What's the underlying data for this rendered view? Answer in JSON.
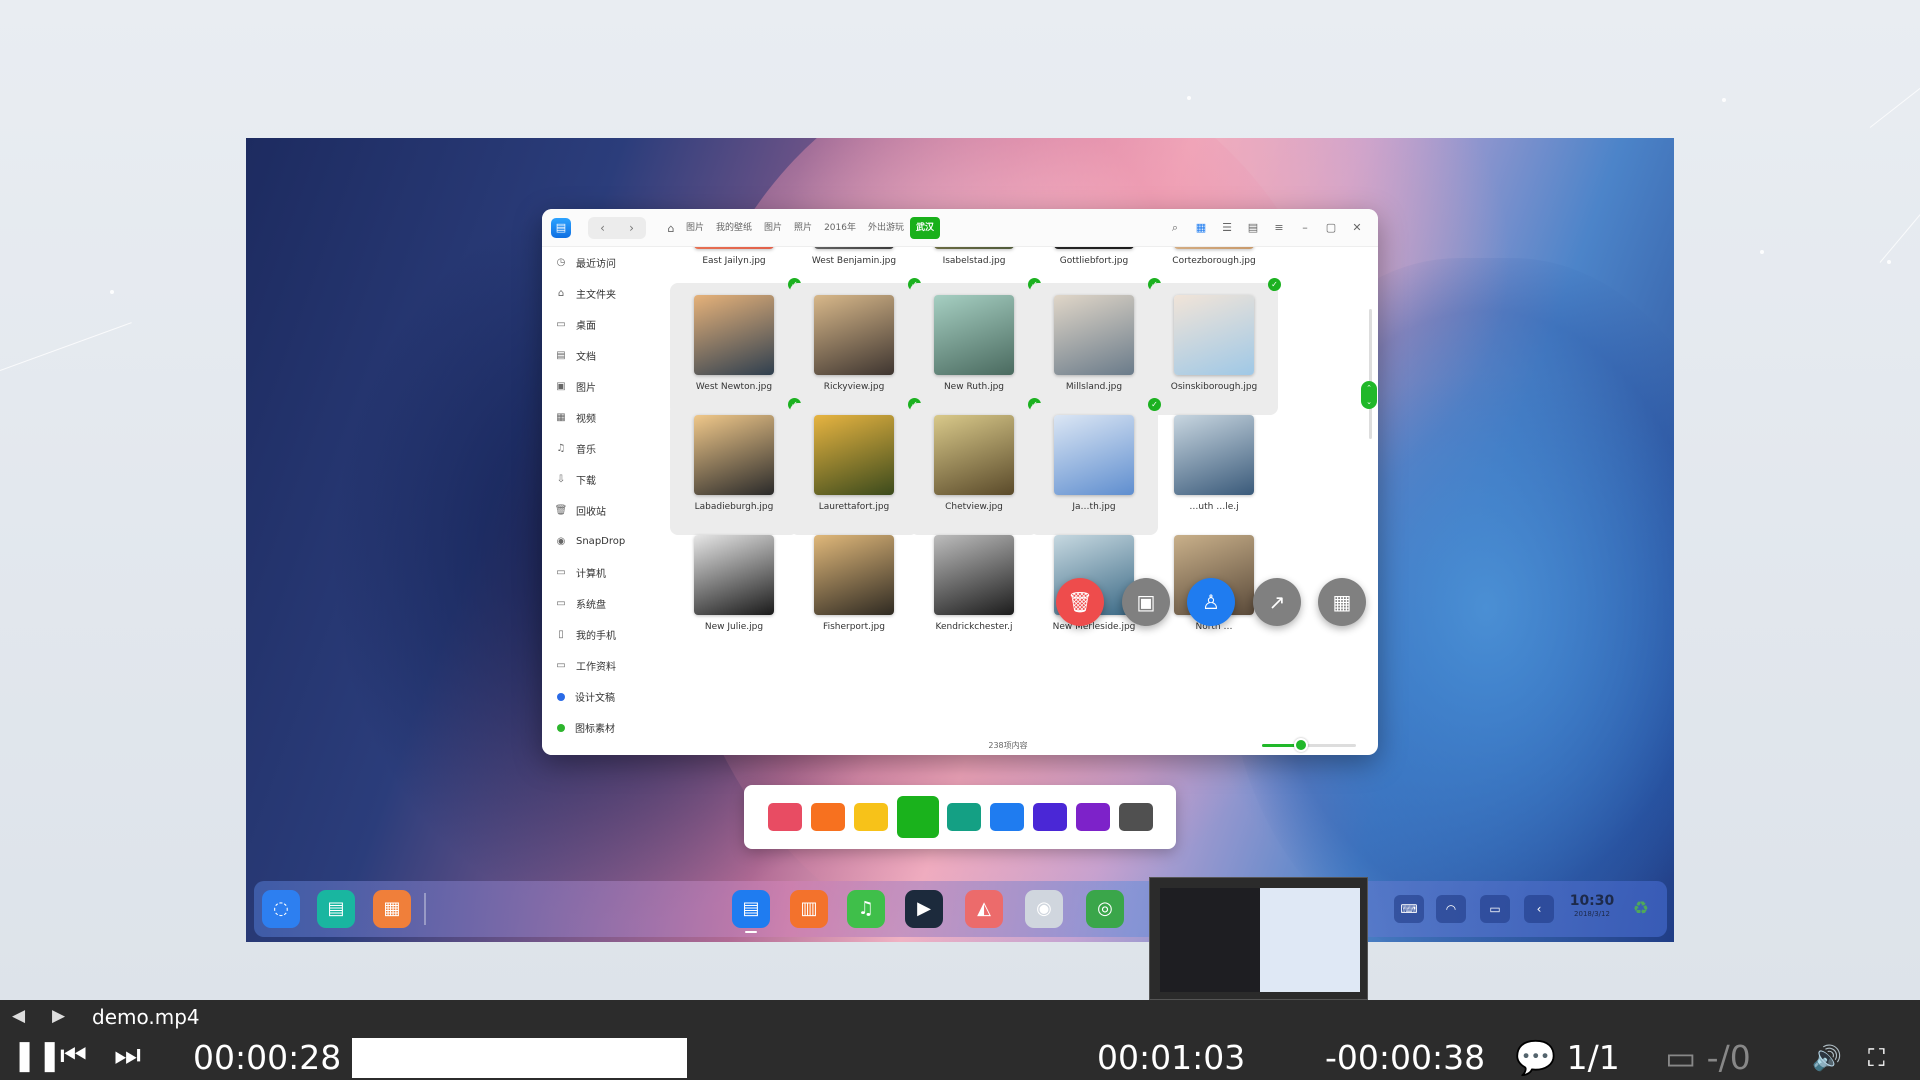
{
  "file_manager": {
    "nav": {
      "back": "‹",
      "forward": "›"
    },
    "breadcrumb": [
      "图片",
      "我的壁纸",
      "图片",
      "照片",
      "2016年",
      "外出游玩",
      "武汉"
    ],
    "sidebar": [
      {
        "label": "最近访问",
        "icon": "◷"
      },
      {
        "label": "主文件夹",
        "icon": "⌂"
      },
      {
        "label": "桌面",
        "icon": "▭"
      },
      {
        "label": "文档",
        "icon": "▤"
      },
      {
        "label": "图片",
        "icon": "▣"
      },
      {
        "label": "视频",
        "icon": "▦"
      },
      {
        "label": "音乐",
        "icon": "♫"
      },
      {
        "label": "下载",
        "icon": "⇩"
      },
      {
        "label": "回收站",
        "icon": "🗑"
      },
      {
        "label": "SnapDrop",
        "icon": "◉"
      },
      {
        "label": "计算机",
        "icon": "▭"
      },
      {
        "label": "系统盘",
        "icon": "▭"
      },
      {
        "label": "我的手机",
        "icon": "▯"
      },
      {
        "label": "工作资料",
        "icon": "▭"
      },
      {
        "label": "设计文稿",
        "dot": "#2a6ae6"
      },
      {
        "label": "图标素材",
        "dot": "#2db52d"
      }
    ],
    "tiles": [
      {
        "name": "East Jailyn.jpg",
        "colors": [
          "#e2604a",
          "#f39a6a"
        ],
        "selected": false
      },
      {
        "name": "West Benjamin.jpg",
        "colors": [
          "#3a3a3a",
          "#cfcfcf"
        ],
        "selected": false
      },
      {
        "name": "Isabelstad.jpg",
        "colors": [
          "#4f5a3a",
          "#b59a5a"
        ],
        "selected": false
      },
      {
        "name": "Gottliebfort.jpg",
        "colors": [
          "#1b1b1b",
          "#444"
        ],
        "selected": false
      },
      {
        "name": "Cortezborough.jpg",
        "colors": [
          "#c8996a",
          "#f0ddc0"
        ],
        "selected": false
      },
      {
        "name": "West Newton.jpg",
        "colors": [
          "#2f3f4f",
          "#e6b27a"
        ],
        "selected": true
      },
      {
        "name": "Rickyview.jpg",
        "colors": [
          "#3e3530",
          "#d8b88a"
        ],
        "selected": true
      },
      {
        "name": "New Ruth.jpg",
        "colors": [
          "#4a6a5f",
          "#a6cfc2"
        ],
        "selected": true
      },
      {
        "name": "Millsland.jpg",
        "colors": [
          "#6a7b8a",
          "#e0d6c8"
        ],
        "selected": true
      },
      {
        "name": "Osinskiborough.jpg",
        "colors": [
          "#9fc8e6",
          "#f1e4d8"
        ],
        "selected": true
      },
      {
        "name": "Labadieburgh.jpg",
        "colors": [
          "#2a2a2a",
          "#f0c88a"
        ],
        "selected": true
      },
      {
        "name": "Laurettafort.jpg",
        "colors": [
          "#3b4a1c",
          "#e7b441"
        ],
        "selected": true
      },
      {
        "name": "Chetview.jpg",
        "colors": [
          "#5a4a2a",
          "#d9c98a"
        ],
        "selected": true
      },
      {
        "name": "Ja…th.jpg",
        "colors": [
          "#5f8ecf",
          "#dbe6f4"
        ],
        "selected": true
      },
      {
        "name": "…uth …le.j",
        "colors": [
          "#3a5a7a",
          "#c8d6e0"
        ],
        "selected": false
      },
      {
        "name": "New Julie.jpg",
        "colors": [
          "#1a1a1a",
          "#e6e6e6"
        ],
        "selected": false
      },
      {
        "name": "Fisherport.jpg",
        "colors": [
          "#2f2a22",
          "#e0b87a"
        ],
        "selected": false
      },
      {
        "name": "Kendrickchester.j",
        "colors": [
          "#1c1c1c",
          "#bdbdbd"
        ],
        "selected": false
      },
      {
        "name": "New Merleside.jpg",
        "colors": [
          "#3c6a86",
          "#c6d8e0"
        ],
        "selected": false
      },
      {
        "name": "North …",
        "colors": [
          "#5a4a3a",
          "#c9b08a"
        ],
        "selected": false
      }
    ],
    "status": "238项内容",
    "zoom_level": 0.42
  },
  "fab_buttons": [
    {
      "icon": "trash-icon",
      "glyph": "🗑",
      "color": "#ee4c4c"
    },
    {
      "icon": "new-folder-icon",
      "glyph": "▣",
      "color": "#808080"
    },
    {
      "icon": "tag-icon",
      "glyph": "♙",
      "color": "#1f7cf0"
    },
    {
      "icon": "share-icon",
      "glyph": "↗",
      "color": "#808080"
    },
    {
      "icon": "grid-icon",
      "glyph": "▦",
      "color": "#808080"
    }
  ],
  "palette": [
    "#e84c63",
    "#f7711f",
    "#f7c219",
    "#1ab21c",
    "#14a084",
    "#1f7cf0",
    "#4a27d6",
    "#7d22c9",
    "#505050"
  ],
  "palette_selected": 3,
  "dock": {
    "apps": [
      {
        "name": "launcher-icon",
        "glyph": "◌",
        "color": "#2d7ff0"
      },
      {
        "name": "multitask-icon",
        "glyph": "▤",
        "color": "#19b6a0"
      },
      {
        "name": "desktop-icon",
        "glyph": "▦",
        "color": "#f07f3a"
      },
      {
        "name": "file-manager-icon",
        "glyph": "▤",
        "color": "#1f7cf0"
      },
      {
        "name": "app-store-icon",
        "glyph": "▥",
        "color": "#f3722c"
      },
      {
        "name": "music-icon",
        "glyph": "♫",
        "color": "#3fbf4a"
      },
      {
        "name": "video-player-icon",
        "glyph": "▶",
        "color": "#1c2a3c"
      },
      {
        "name": "image-viewer-icon",
        "glyph": "◭",
        "color": "#ec6b6b"
      },
      {
        "name": "camera-icon",
        "glyph": "◉",
        "color": "#d0d6de"
      },
      {
        "name": "browser-icon",
        "glyph": "◎",
        "color": "#3aa64a"
      }
    ],
    "tray": [
      "⌨",
      "◠",
      "▭",
      "‹"
    ],
    "clock_time": "10:30",
    "clock_date": "2018/3/12",
    "trash_glyph": "♻"
  },
  "player": {
    "prev_arrow": "◀",
    "next_arrow": "▶",
    "file_name": "demo.mp4",
    "pause_glyph": "❚❚",
    "skip_back_glyph": "⏮",
    "skip_fwd_glyph": "⏭",
    "current_time": "00:00:28",
    "hover_time": "00:01:03",
    "remaining_time": "-00:00:38",
    "subtitle": "💬 1/1",
    "audio_track": "▭ -/0",
    "volume_glyph": "🔊",
    "fullscreen_glyph": "⛶",
    "progress": 0.35
  }
}
